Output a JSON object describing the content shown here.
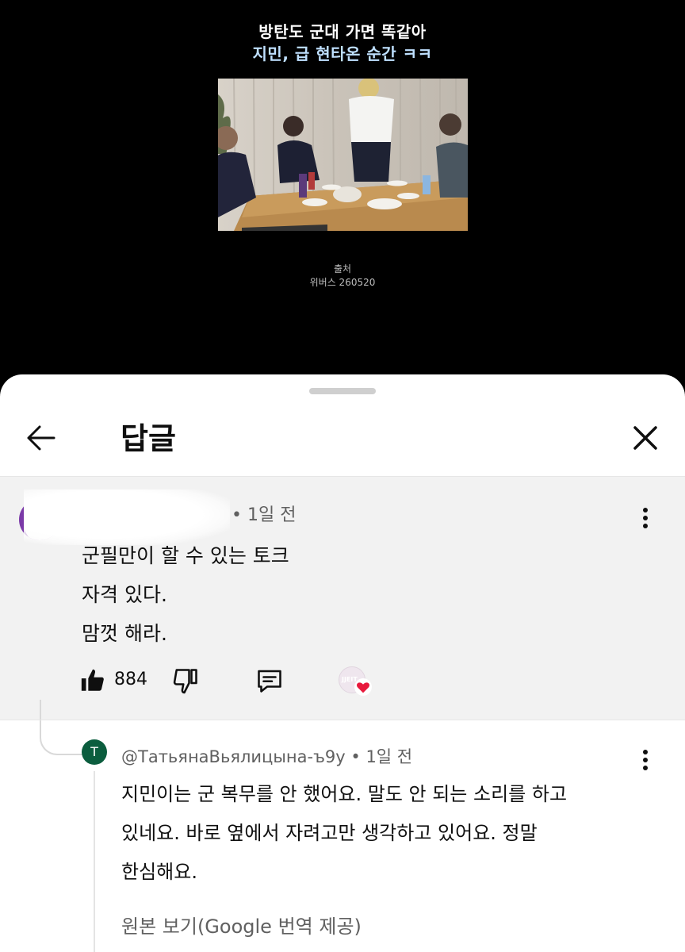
{
  "video": {
    "caption_line1": "방탄도 군대 가면 똑같아",
    "caption_line2": "지민, 급 현타온 순간 ㅋㅋ",
    "source_label": "출처",
    "source_value": "위버스 260520"
  },
  "sheet": {
    "title": "답글",
    "back_icon": "arrow-left-icon",
    "close_icon": "close-icon"
  },
  "parent_comment": {
    "meta": "• 1일 전",
    "lines": [
      "군필만이 할 수 있는 토크",
      "자격 있다.",
      "맘껏 해라."
    ],
    "like_count": "884",
    "creator_heart_badge": "JJEIT"
  },
  "reply": {
    "avatar_letter": "T",
    "meta": "@ТатьянаВьялицына-ъ9у • 1일 전",
    "lines": [
      "지민이는 군 복무를 안 했어요. 말도 안 되는 소리를 하고",
      "있네요. 바로 옆에서 자려고만 생각하고 있어요. 정말",
      "한심해요."
    ],
    "original_link": "원본 보기(Google 번역 제공)"
  },
  "colors": {
    "background": "#000000",
    "sheet": "#ffffff",
    "highlight": "#f2f2f2",
    "caption_accent": "#bfe0ff",
    "heart": "#e8193c",
    "reply_avatar": "#0b5d3e"
  }
}
